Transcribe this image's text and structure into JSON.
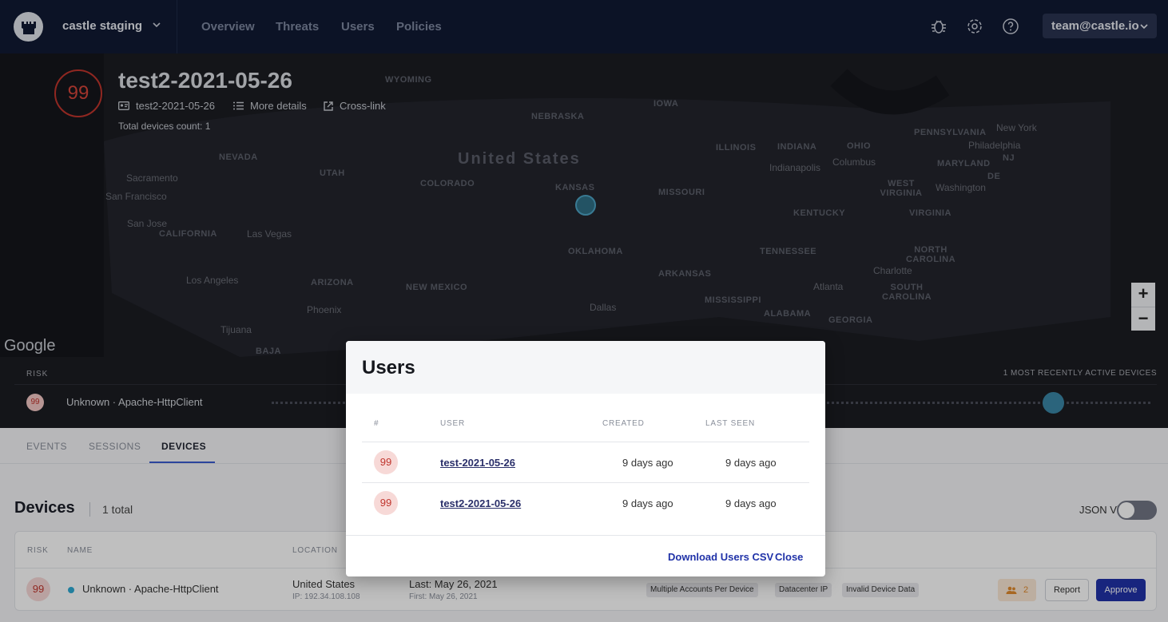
{
  "topnav": {
    "project": "castle staging",
    "links": [
      "Overview",
      "Threats",
      "Users",
      "Policies"
    ],
    "account": "team@castle.io"
  },
  "hero": {
    "risk_score": "99",
    "title": "test2-2021-05-26",
    "user_id": "test2-2021-05-26",
    "more_details": "More details",
    "cross_link": "Cross-link",
    "device_count": "Total devices count: 1",
    "google": "Google",
    "zoom_in": "+",
    "zoom_out": "−",
    "risk_header": "RISK",
    "recent_header": "1 MOST RECENTLY ACTIVE DEVICES",
    "device_risk": "99",
    "device_line": "Unknown · Apache-HttpClient",
    "map": {
      "country": "United States",
      "states": [
        "WYOMING",
        "NEBRASKA",
        "IOWA",
        "NEVADA",
        "UTAH",
        "COLORADO",
        "KANSAS",
        "MISSOURI",
        "ILLINOIS",
        "INDIANA",
        "OHIO",
        "CALIFORNIA",
        "ARIZONA",
        "NEW MEXICO",
        "OKLAHOMA",
        "ARKANSAS",
        "TENNESSEE",
        "KENTUCKY",
        "WEST VIRGINIA",
        "VIRGINIA",
        "NORTH CAROLINA",
        "SOUTH CAROLINA",
        "MISSISSIPPI",
        "ALABAMA",
        "GEORGIA",
        "PENNSYLVANIA",
        "MARYLAND",
        "DE",
        "NJ",
        "BAJA"
      ],
      "cities": [
        "Sacramento",
        "San Francisco",
        "San Jose",
        "Las Vegas",
        "Los Angeles",
        "Phoenix",
        "Tijuana",
        "Dallas",
        "Indianapolis",
        "Columbus",
        "Washington",
        "Philadelphia",
        "New York",
        "Charlotte",
        "Atlanta"
      ]
    }
  },
  "tabs": [
    "EVENTS",
    "SESSIONS",
    "DEVICES"
  ],
  "devices": {
    "title": "Devices",
    "count": "1 total",
    "json_view": "JSON View",
    "columns": [
      "RISK",
      "NAME",
      "LOCATION"
    ],
    "row": {
      "risk": "99",
      "name": "Unknown · Apache-HttpClient",
      "location": "United States",
      "ip": "IP: 192.34.108.108",
      "last": "Last: May 26, 2021",
      "first": "First: May 26, 2021",
      "tags": [
        "Multiple Accounts Per Device",
        "Datacenter IP",
        "Invalid Device Data"
      ],
      "users_count": "2",
      "report": "Report",
      "approve": "Approve"
    }
  },
  "modal": {
    "title": "Users",
    "columns": [
      "#",
      "USER",
      "CREATED",
      "LAST SEEN"
    ],
    "rows": [
      {
        "risk": "99",
        "user": "test-2021-05-26",
        "created": "9 days ago",
        "last_seen": "9 days ago"
      },
      {
        "risk": "99",
        "user": "test2-2021-05-26",
        "created": "9 days ago",
        "last_seen": "9 days ago"
      }
    ],
    "download": "Download Users CSV",
    "close": "Close"
  }
}
